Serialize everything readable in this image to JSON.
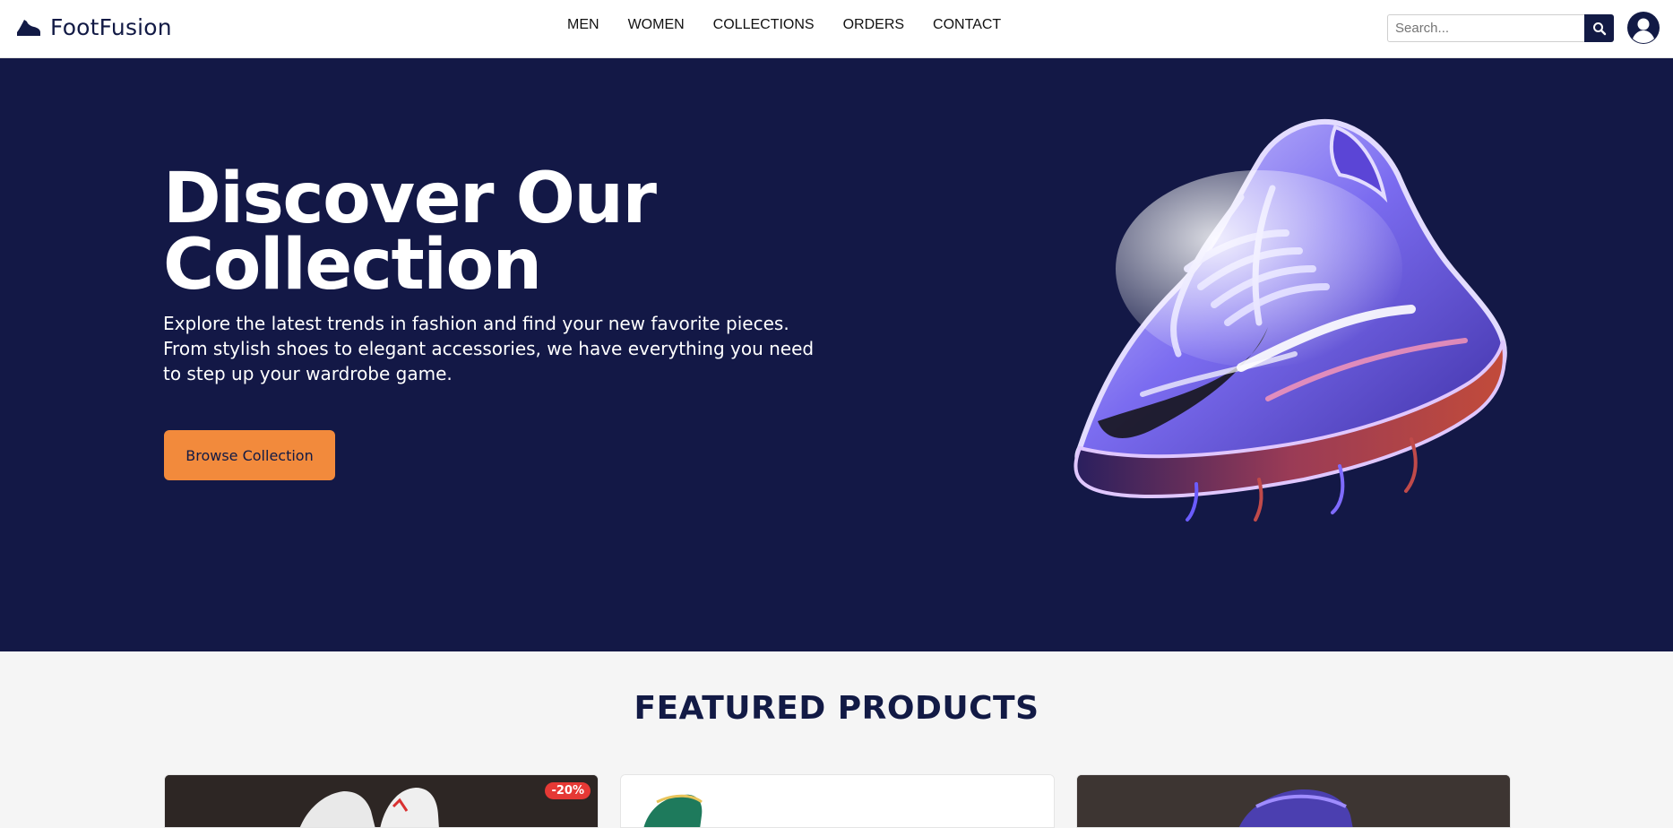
{
  "brand": {
    "name": "FootFusion",
    "logo_icon": "shoe-icon"
  },
  "nav": {
    "items": [
      {
        "label": "MEN"
      },
      {
        "label": "WOMEN"
      },
      {
        "label": "COLLECTIONS"
      },
      {
        "label": "ORDERS"
      },
      {
        "label": "CONTACT"
      }
    ]
  },
  "search": {
    "placeholder": "Search...",
    "value": "",
    "icon": "search-icon"
  },
  "account": {
    "icon": "user-account-icon"
  },
  "hero": {
    "title_line1": "Discover Our",
    "title_line2": "Collection",
    "subtitle": "Explore the latest trends in fashion and find your new favorite pieces. From stylish shoes to elegant accessories, we have everything you need to step up your wardrobe game.",
    "cta_label": "Browse Collection",
    "image_icon": "sneaker-image"
  },
  "featured": {
    "title": "FEATURED PRODUCTS",
    "cards": [
      {
        "badge": "-20%"
      },
      {
        "badge": ""
      },
      {
        "badge": ""
      }
    ]
  },
  "colors": {
    "navy": "#131846",
    "accent_orange": "#f28a3c",
    "badge_red": "#e53935",
    "header_bg": "#ffffff",
    "section_bg": "#f5f5f5"
  }
}
